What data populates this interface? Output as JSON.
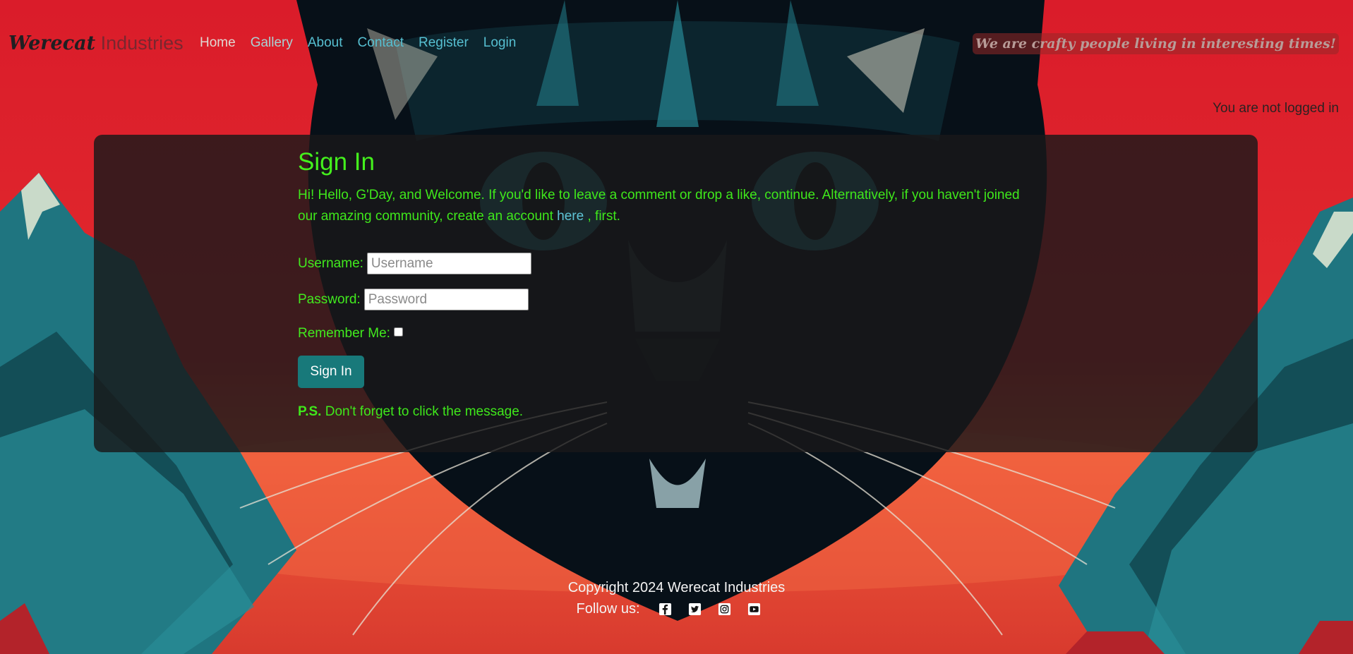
{
  "brand": {
    "part1": "Werecat",
    "part2": " Industries"
  },
  "nav": {
    "items": [
      {
        "label": "Home"
      },
      {
        "label": "Gallery"
      },
      {
        "label": "About"
      },
      {
        "label": "Contact"
      },
      {
        "label": "Register"
      },
      {
        "label": "Login"
      }
    ]
  },
  "header": {
    "tagline": "We are crafty people living in interesting times!",
    "login_status": "You are not logged in"
  },
  "signin": {
    "title": "Sign In",
    "intro_before": "Hi! Hello, G'Day, and Welcome. If you'd like to leave a comment or drop a like, continue. Alternatively, if you haven't joined our amazing community, create an account ",
    "intro_link": "here",
    "intro_after": " , first.",
    "username_label": "Username:",
    "username_placeholder": "Username",
    "username_value": "",
    "password_label": "Password:",
    "password_placeholder": "Password",
    "password_value": "",
    "remember_label": "Remember Me:",
    "remember_checked": false,
    "button_label": "Sign In",
    "ps_bold": "P.S.",
    "ps_text": " Don't forget to click the message."
  },
  "footer": {
    "copyright": "Copyright 2024 Werecat Industries",
    "follow_label": "Follow us:",
    "social_icons": [
      "facebook-icon",
      "twitter-icon",
      "instagram-icon",
      "youtube-icon"
    ]
  },
  "colors": {
    "background_red": "#d91e2a",
    "panel": "#19181a",
    "accent_green": "#3fe81b",
    "link_teal": "#56bfd1",
    "button_teal": "#18797a"
  }
}
